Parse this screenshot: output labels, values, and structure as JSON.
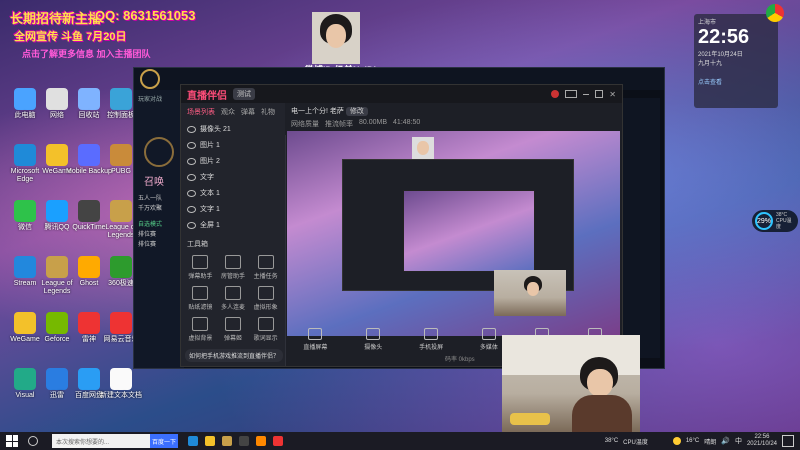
{
  "overlay": {
    "line1": "长期招待新主播",
    "line2": "QQ: 8631561053",
    "line3": "全网宣传 斗鱼 7月20日",
    "line4": "点击了解更多信息 加入主播团队",
    "watermark": "微博ID:奶弟NaiDi"
  },
  "desktop_icons": [
    {
      "label": "此电脑"
    },
    {
      "label": "网络"
    },
    {
      "label": "回收站"
    },
    {
      "label": "控制面板"
    },
    {
      "label": "Microsoft Edge"
    },
    {
      "label": "WeGame"
    },
    {
      "label": "Mobile Backup"
    },
    {
      "label": "PUBG"
    },
    {
      "label": "微信"
    },
    {
      "label": "腾讯QQ"
    },
    {
      "label": "QuickTime"
    },
    {
      "label": "League of Legends"
    },
    {
      "label": "Stream"
    },
    {
      "label": "League of Legends"
    },
    {
      "label": "Ghost"
    },
    {
      "label": "360极速"
    },
    {
      "label": "WeGame"
    },
    {
      "label": "Geforce"
    },
    {
      "label": "雷神"
    },
    {
      "label": "网易云音乐"
    },
    {
      "label": "Visual"
    },
    {
      "label": "迅雷"
    },
    {
      "label": "百度网盘"
    },
    {
      "label": "新建文本文档"
    }
  ],
  "lol_client": {
    "title": "英雄联盟",
    "nav": [
      "玩家对战",
      "主页",
      "召唤师"
    ],
    "summoner_heading": "召唤",
    "panel_lines": [
      "五人一队",
      "千万欢聚",
      "自选模式",
      "排位赛",
      "排位赛"
    ]
  },
  "stream_app": {
    "logo": "直播伴侣",
    "badge": "测试",
    "tabs": [
      "场景列表",
      "观众",
      "弹幕",
      "礼物"
    ],
    "scenes": [
      {
        "label": "摄像头 21"
      },
      {
        "label": "图片 1"
      },
      {
        "label": "图片 2"
      },
      {
        "label": "文字"
      },
      {
        "label": "文本 1"
      },
      {
        "label": "文字 1"
      },
      {
        "label": "全屏 1"
      }
    ],
    "tools_title": "工具箱",
    "tools": [
      "弹幕助手",
      "房管助手",
      "主播任务",
      "贴纸滤镜",
      "多人连麦",
      "虚拟形象",
      "虚拟背景",
      "弹幕姬",
      "歌词显示"
    ],
    "tip": "如何把手机游戏推流到直播伴侣？",
    "room_title": "电一上个分! 老萨",
    "room_edit": "修改",
    "room_meta": [
      "网络质量",
      "推流帧率",
      "80.00MB",
      "41:48:50"
    ],
    "bottom_tools": [
      "直播屏幕",
      "摄像头",
      "手机投屏",
      "多媒体",
      "连麦",
      "扬声器"
    ],
    "status": "码率 0kbps"
  },
  "widget": {
    "time": "22:56",
    "date_line": "2021年10月24日",
    "lunar": "九月十九",
    "weather_title": "上海市",
    "hint": "点击查看"
  },
  "cpu": {
    "percent": "29%",
    "temp": "38°C",
    "label": "CPU温度"
  },
  "taskbar": {
    "search_placeholder": "本次搜索你想要的...",
    "search_button": "百度一下",
    "temp": "16°C",
    "weather": "晴朗",
    "time": "22:56",
    "date": "2021/10/24",
    "cpu_temp": "38°C",
    "cpu_label": "CPU温度"
  }
}
